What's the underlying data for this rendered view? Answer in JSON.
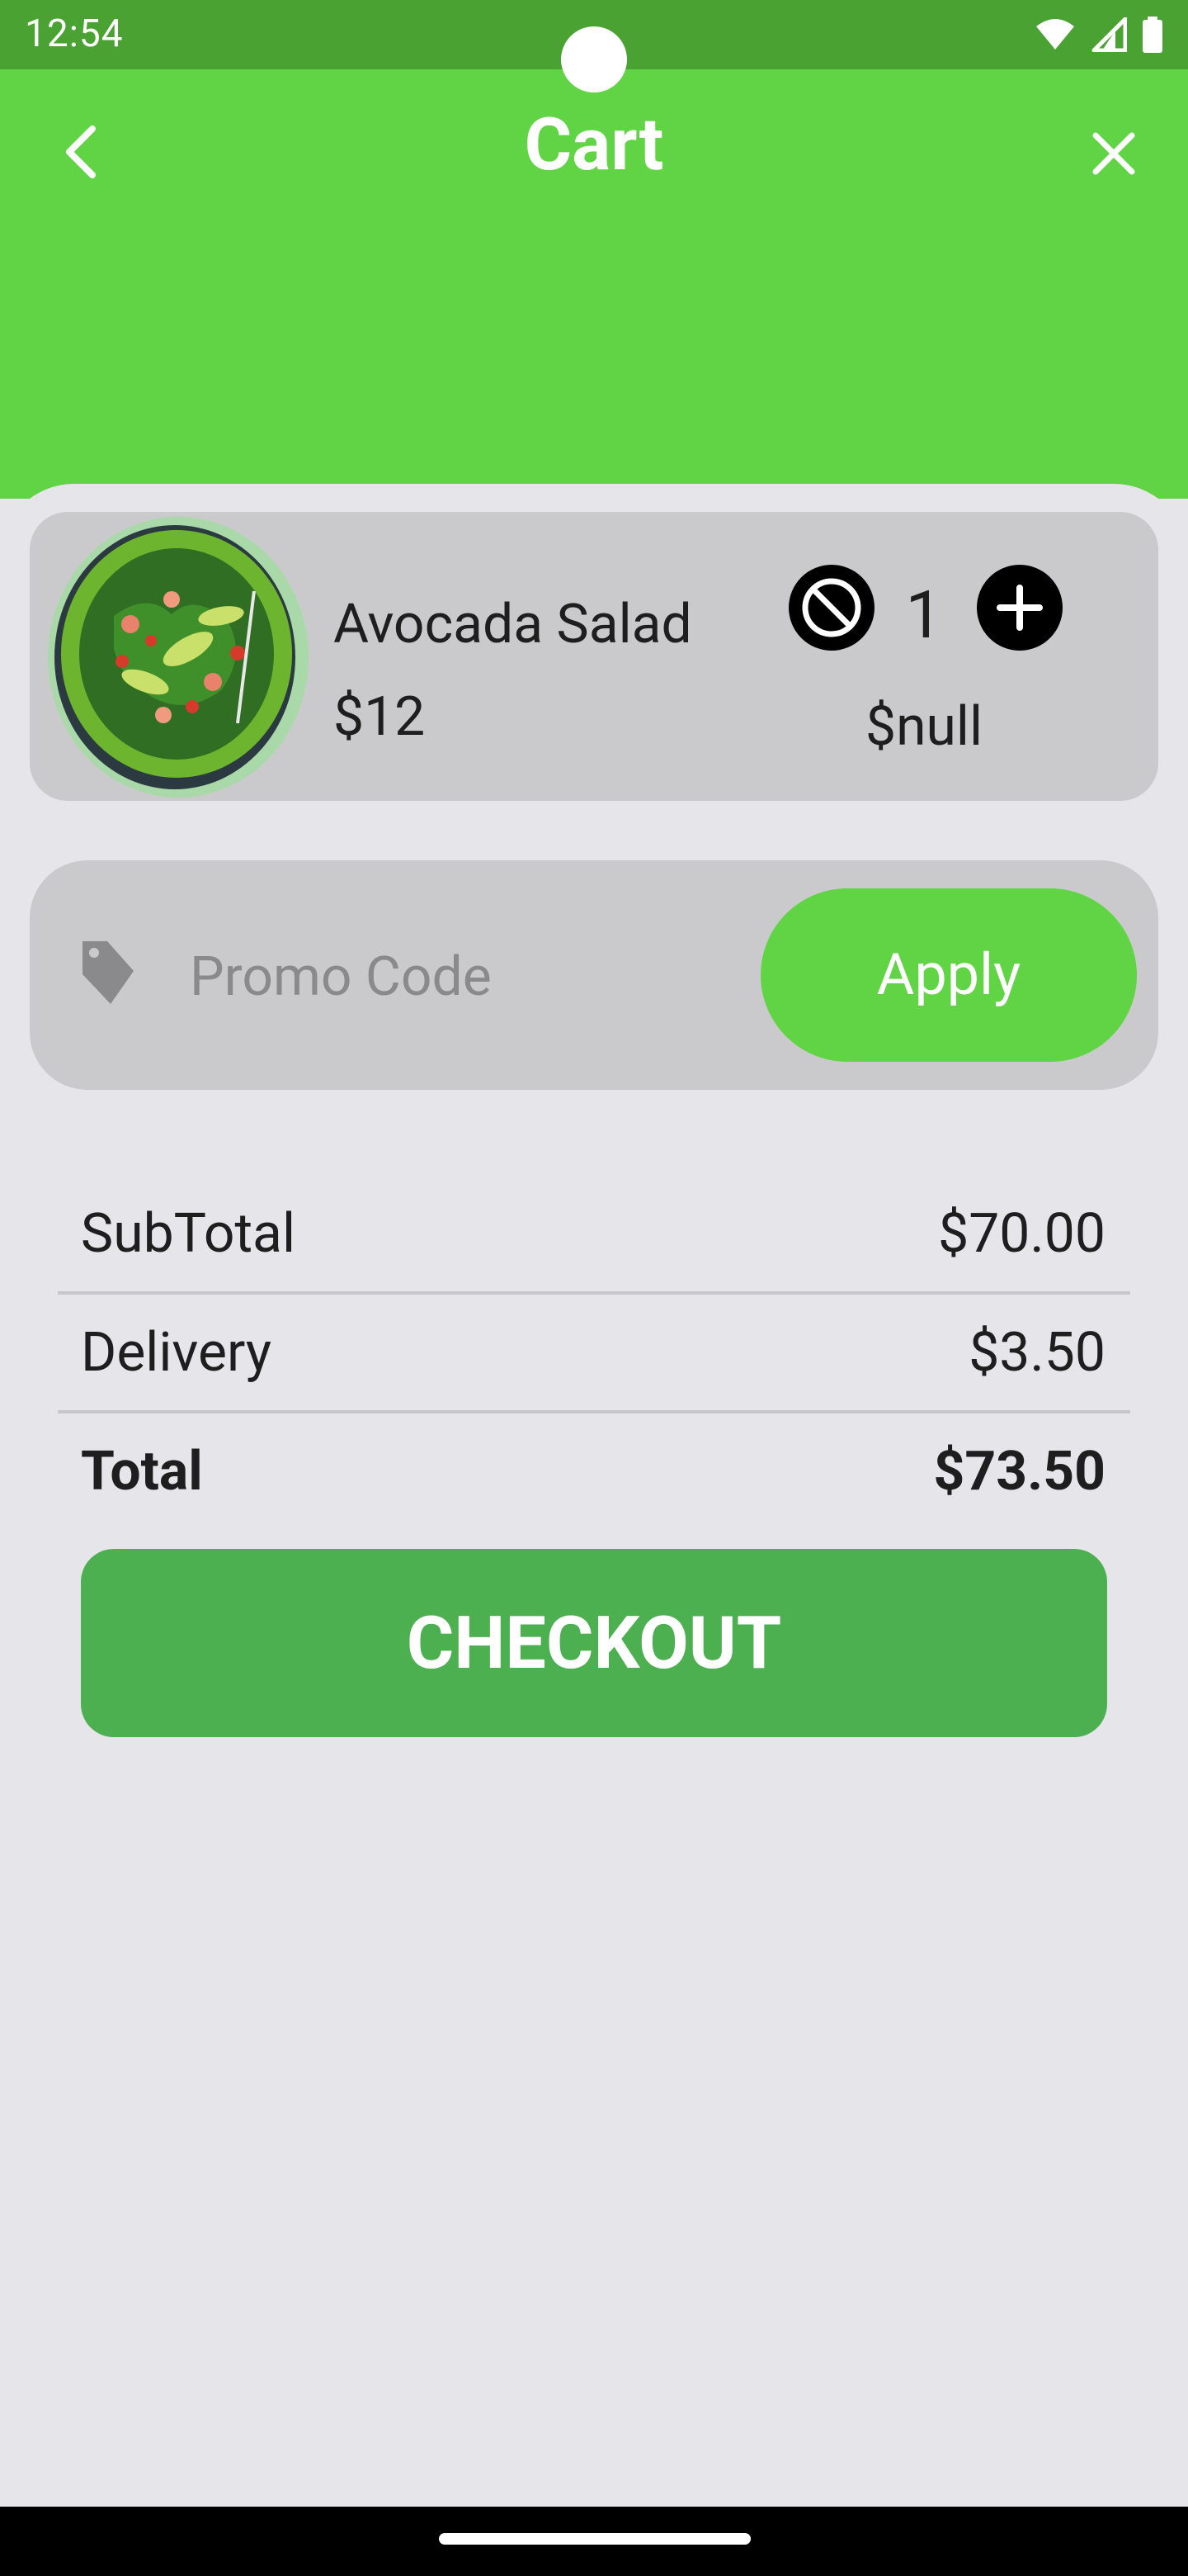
{
  "status_bar": {
    "time": "12:54"
  },
  "header": {
    "title": "Cart"
  },
  "cart_items": [
    {
      "name": "Avocada Salad",
      "price": "$12",
      "quantity": "1",
      "line_total": "$null"
    }
  ],
  "promo": {
    "placeholder": "Promo Code",
    "value": "",
    "apply_label": "Apply"
  },
  "summary": {
    "subtotal_label": "SubTotal",
    "subtotal_value": "$70.00",
    "delivery_label": "Delivery",
    "delivery_value": "$3.50",
    "total_label": "Total",
    "total_value": "$73.50"
  },
  "checkout_label": "CHECKOUT",
  "colors": {
    "header_green": "#61d445",
    "status_green": "#4aa232",
    "checkout_green": "#4caf50",
    "card_gray": "#cacacc",
    "background": "#e6e5ea"
  }
}
